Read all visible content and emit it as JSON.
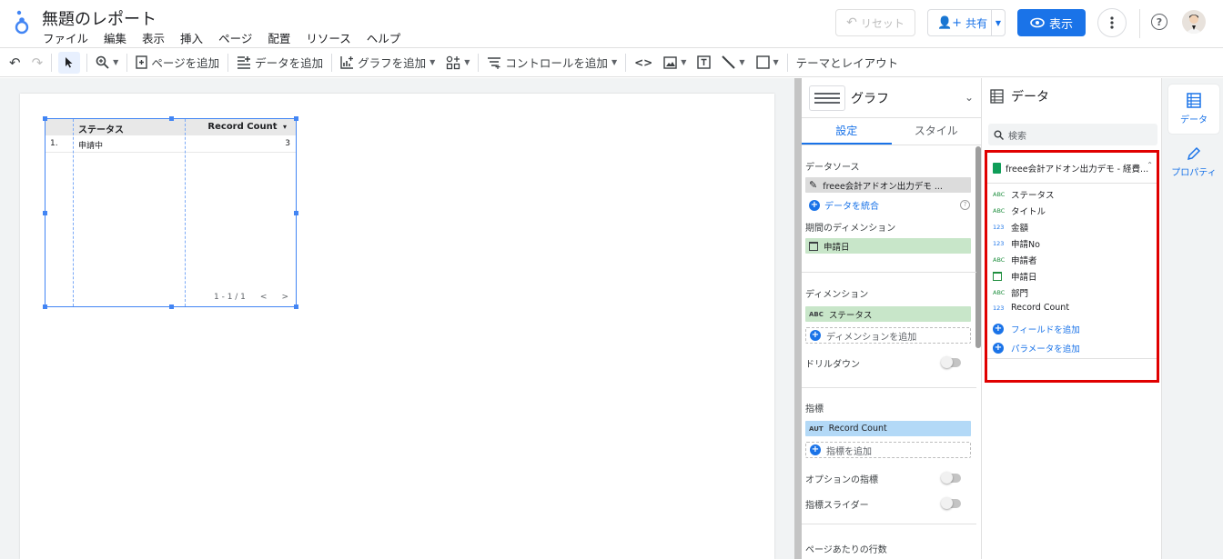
{
  "header": {
    "title": "無題のレポート",
    "menu": [
      "ファイル",
      "編集",
      "表示",
      "挿入",
      "ページ",
      "配置",
      "リソース",
      "ヘルプ"
    ],
    "reset_label": "リセット",
    "share_label": "共有",
    "view_label": "表示"
  },
  "toolbar": {
    "add_page": "ページを追加",
    "add_data": "データを追加",
    "add_chart": "グラフを追加",
    "add_control": "コントロールを追加",
    "theme_layout": "テーマとレイアウト"
  },
  "table": {
    "headers": [
      "ステータス",
      "Record Count"
    ],
    "sort_indicator": "▾",
    "rows": [
      {
        "n": "1.",
        "status": "申請中",
        "count": "3"
      }
    ],
    "pager": "1 - 1 / 1",
    "prev": "<",
    "next": ">"
  },
  "chart_panel": {
    "title": "グラフ",
    "tabs": [
      "設定",
      "スタイル"
    ],
    "data_source_label": "データソース",
    "data_source": "freee会計アドオン出力デモ ...",
    "blend_data": "データを統合",
    "date_dim_label": "期間のディメンション",
    "date_dim": "申請日",
    "dim_label": "ディメンション",
    "dim": "ステータス",
    "dim_tag": "ABC",
    "add_dim": "ディメンションを追加",
    "drilldown": "ドリルダウン",
    "metric_label": "指標",
    "metric": "Record Count",
    "metric_tag": "AUT",
    "add_metric": "指標を追加",
    "optional_metric": "オプションの指標",
    "metric_slider": "指標スライダー",
    "rows_per_page": "ページあたりの行数"
  },
  "data_panel": {
    "title": "データ",
    "search_placeholder": "検索",
    "source_name": "freee会計アドオン出力デモ - 経費...",
    "fields": [
      {
        "type": "ABC",
        "name": "ステータス"
      },
      {
        "type": "ABC",
        "name": "タイトル"
      },
      {
        "type": "123",
        "name": "金額"
      },
      {
        "type": "123",
        "name": "申請No"
      },
      {
        "type": "ABC",
        "name": "申請者"
      },
      {
        "type": "date",
        "name": "申請日"
      },
      {
        "type": "ABC",
        "name": "部門"
      },
      {
        "type": "123",
        "name": "Record Count"
      }
    ],
    "add_field": "フィールドを追加",
    "add_parameter": "パラメータを追加"
  },
  "rail": {
    "data_label": "データ",
    "properties_label": "プロパティ"
  },
  "colors": {
    "accent": "#1a73e8",
    "highlight": "#e00000"
  }
}
